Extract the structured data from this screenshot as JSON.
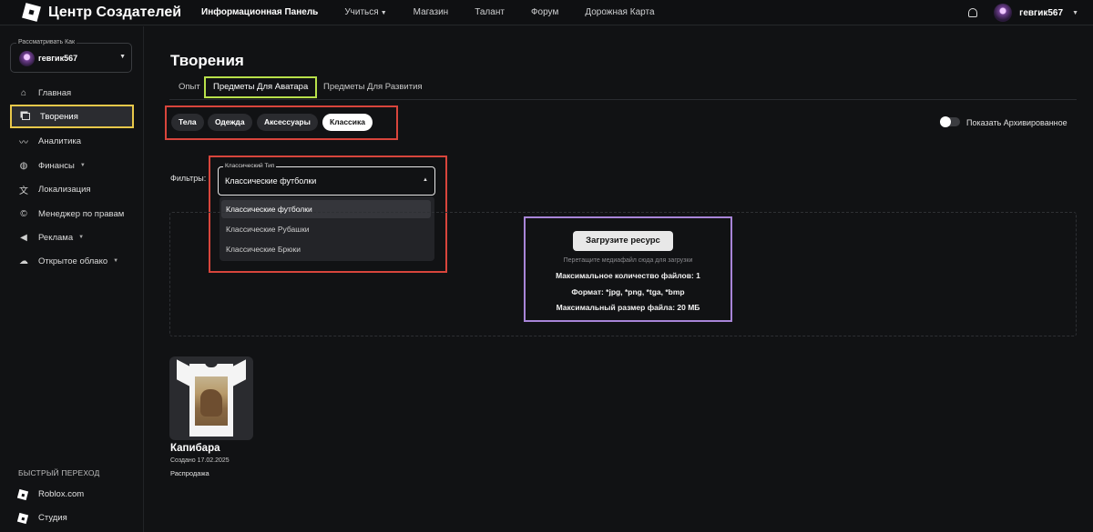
{
  "header": {
    "brand": "Центр Создателей",
    "nav": [
      {
        "label": "Информационная Панель",
        "active": true
      },
      {
        "label": "Учиться",
        "has_dropdown": true
      },
      {
        "label": "Магазин"
      },
      {
        "label": "Талант"
      },
      {
        "label": "Форум"
      },
      {
        "label": "Дорожная Карта"
      }
    ],
    "username": "гeвгик567"
  },
  "sidebar": {
    "view_as_label": "Рассматривать Как",
    "view_as_user": "гeвгик567",
    "items": [
      {
        "label": "Главная",
        "icon": "home-icon"
      },
      {
        "label": "Творения",
        "icon": "creations-icon",
        "active": true
      },
      {
        "label": "Аналитика",
        "icon": "analytics-icon"
      },
      {
        "label": "Финансы",
        "icon": "finance-icon",
        "has_dropdown": true
      },
      {
        "label": "Локализация",
        "icon": "translate-icon"
      },
      {
        "label": "Менеджер по правам",
        "icon": "copyright-icon"
      },
      {
        "label": "Реклама",
        "icon": "megaphone-icon",
        "has_dropdown": true
      },
      {
        "label": "Открытое облако",
        "icon": "cloud-icon",
        "has_dropdown": true
      }
    ],
    "quick_title": "БЫСТРЫЙ ПЕРЕХОД",
    "quick_items": [
      {
        "label": "Roblox.com",
        "icon": "roblox-icon"
      },
      {
        "label": "Студия",
        "icon": "studio-icon"
      }
    ]
  },
  "main": {
    "title": "Творения",
    "tabs": [
      {
        "label": "Опыт"
      },
      {
        "label": "Предметы Для Аватара",
        "active": true
      },
      {
        "label": "Предметы Для Развития"
      }
    ],
    "chips": [
      {
        "label": "Тела"
      },
      {
        "label": "Одежда"
      },
      {
        "label": "Аксессуары"
      },
      {
        "label": "Классика",
        "active": true
      }
    ],
    "archived_toggle_label": "Показать Архивированное",
    "archived_toggle_on": false,
    "filters_label": "Фильтры:",
    "filter_select": {
      "legend": "Классический Тип",
      "value": "Классические футболки",
      "options": [
        "Классические футболки",
        "Классические Рубашки",
        "Классические Брюки"
      ]
    },
    "upload": {
      "button": "Загрузите ресурс",
      "hint": "Перетащите медиафайл сюда для загрузки",
      "max_files": "Максимальное количество файлов: 1",
      "format": "Формат: *jpg, *png, *tga, *bmp",
      "max_size": "Максимальный размер файла: 20 МБ"
    },
    "items": [
      {
        "name": "Капибара",
        "created": "Создано 17.02.2025",
        "status": "Распродажа"
      }
    ]
  },
  "colors": {
    "background": "#111214",
    "highlight_yellow": "#e8c84a",
    "highlight_green": "#b8e04a",
    "highlight_red": "#d8453c",
    "highlight_purple": "#a885d8"
  }
}
